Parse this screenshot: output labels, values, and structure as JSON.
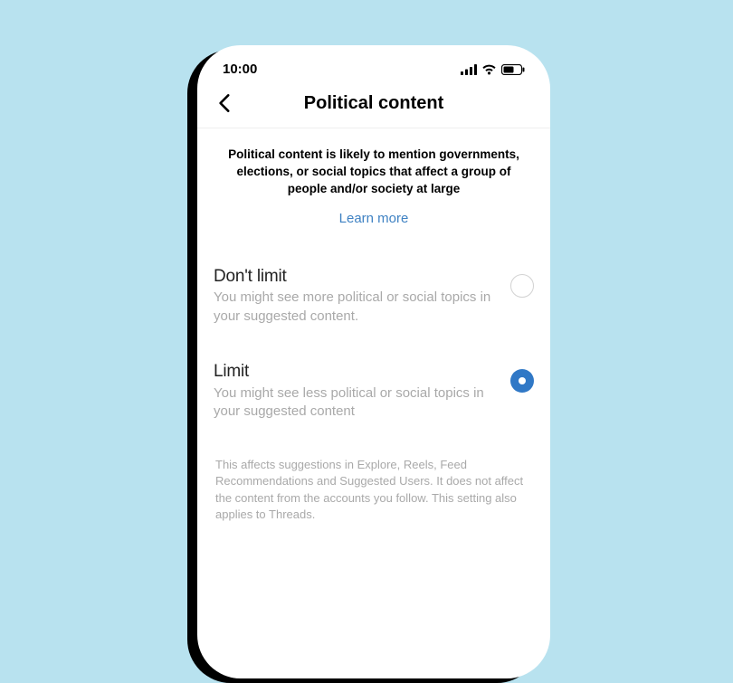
{
  "status": {
    "time": "10:00"
  },
  "header": {
    "title": "Political content"
  },
  "intro": {
    "text": "Political content is likely to mention governments, elections, or social topics that affect a group of people and/or society at large",
    "link": "Learn more"
  },
  "options": [
    {
      "title": "Don't limit",
      "desc": "You might see more political or social topics in your suggested content.",
      "selected": false
    },
    {
      "title": "Limit",
      "desc": "You might see less political or social topics in your suggested content",
      "selected": true
    }
  ],
  "footer": "This affects suggestions in Explore, Reels, Feed Recommendations and Suggested Users. It does not affect the content from the accounts you follow. This setting also applies to Threads."
}
